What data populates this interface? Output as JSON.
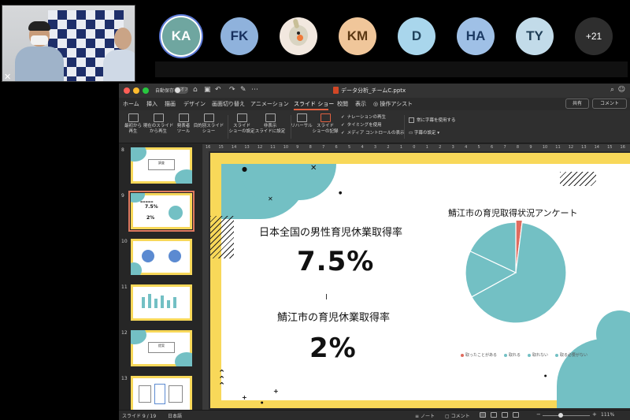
{
  "meeting": {
    "participants": [
      {
        "initials": "KA",
        "bg": "#6fa6a0",
        "fg": "#ffffff",
        "selected": true
      },
      {
        "initials": "FK",
        "bg": "#8fb2dc",
        "fg": "#17305e"
      },
      {
        "initials": "",
        "bg": "#f2e8df",
        "fg": "#333333",
        "icon": "cockatiel-avatar-icon"
      },
      {
        "initials": "KM",
        "bg": "#f0c69a",
        "fg": "#5b3813"
      },
      {
        "initials": "D",
        "bg": "#a9d6ec",
        "fg": "#20435c"
      },
      {
        "initials": "HA",
        "bg": "#9fc0e6",
        "fg": "#1d3b64"
      },
      {
        "initials": "TY",
        "bg": "#c2dbe9",
        "fg": "#1e3d55"
      }
    ],
    "more_count": "+21"
  },
  "ppt": {
    "autosave_label": "自動保存",
    "autosave_state": "オフ",
    "doc_title": "データ分析_チームC.pptx",
    "tabs": [
      "ホーム",
      "挿入",
      "描画",
      "デザイン",
      "画面切り替え",
      "アニメーション",
      "スライド ショー",
      "校閲",
      "表示",
      "操作アシスト"
    ],
    "active_tab": "スライド ショー",
    "share_label": "共有",
    "comment_label": "コメント",
    "ribbon": {
      "from_start": "最初から\n再生",
      "from_current": "現在のスライド\nから再生",
      "presenter_tools": "発表者\nツール",
      "custom_show": "目的別スライド\nショー",
      "setup_show": "スライド\nショーの設定",
      "hide_slide": "非表示\nスライドに設定",
      "rehearse": "リハーサル",
      "record": "スライド\nショーの記録",
      "narration": "ナレーションの再生",
      "timing": "タイミングを使用",
      "media_controls": "メディア コントロールの表示",
      "always_subtitles": "常に字幕を使用する",
      "subtitle_settings": "字幕の設定"
    },
    "thumbnails": [
      {
        "num": "8",
        "label": "調査"
      },
      {
        "num": "9",
        "label": "",
        "big1": "7.5%",
        "big2": "2%"
      },
      {
        "num": "10",
        "label": ""
      },
      {
        "num": "11",
        "label": ""
      },
      {
        "num": "12",
        "label": "提案"
      },
      {
        "num": "13",
        "label": ""
      }
    ],
    "ruler_marks": [
      "16",
      "15",
      "14",
      "13",
      "12",
      "11",
      "10",
      "9",
      "8",
      "7",
      "6",
      "5",
      "4",
      "3",
      "2",
      "1",
      "0",
      "1",
      "2",
      "3",
      "4",
      "5",
      "6",
      "7",
      "8",
      "9",
      "10",
      "11",
      "12",
      "13",
      "14",
      "15",
      "16"
    ],
    "slide": {
      "national_title": "日本全国の男性育児休業取得率",
      "national_value": "7.5%",
      "city_title": "鯖江市の育児休業取得率",
      "city_value": "2%"
    },
    "status": {
      "slide_pos": "スライド 9 / 19",
      "language": "日本語",
      "notes": "ノート",
      "comments": "コメント",
      "zoom": "111%"
    }
  },
  "chart_data": {
    "type": "pie",
    "title": "鯖江市の育児取得状況アンケート",
    "categories": [
      "取ったことがある",
      "取れる",
      "取れない",
      "取る必要がない"
    ],
    "values": [
      2,
      65,
      15,
      18
    ],
    "colors": [
      "#e06c5f",
      "#73c0c4",
      "#73c0c4",
      "#73c0c4"
    ],
    "legend_position": "bottom"
  },
  "colors": {
    "slide_yellow": "#f8d859",
    "slide_teal": "#73c0c4",
    "accent_red": "#e06c5f"
  }
}
